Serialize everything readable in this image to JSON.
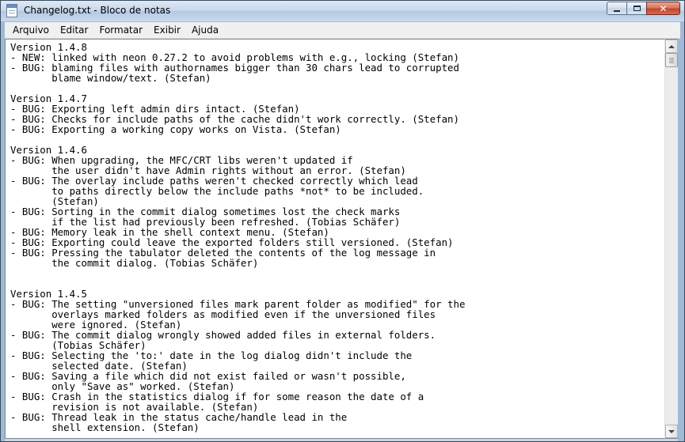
{
  "window": {
    "title": "Changelog.txt - Bloco de notas",
    "caption_buttons": {
      "minimize": "minimize",
      "maximize": "maximize",
      "close": "close"
    }
  },
  "menubar": {
    "items": [
      {
        "label": "Arquivo"
      },
      {
        "label": "Editar"
      },
      {
        "label": "Formatar"
      },
      {
        "label": "Exibir"
      },
      {
        "label": "Ajuda"
      }
    ]
  },
  "editor": {
    "lines": [
      "Version 1.4.8",
      "- NEW: linked with neon 0.27.2 to avoid problems with e.g., locking (Stefan)",
      "- BUG: blaming files with authornames bigger than 30 chars lead to corrupted",
      "       blame window/text. (Stefan)",
      "",
      "Version 1.4.7",
      "- BUG: Exporting left admin dirs intact. (Stefan)",
      "- BUG: Checks for include paths of the cache didn't work correctly. (Stefan)",
      "- BUG: Exporting a working copy works on Vista. (Stefan)",
      "",
      "Version 1.4.6",
      "- BUG: When upgrading, the MFC/CRT libs weren't updated if",
      "       the user didn't have Admin rights without an error. (Stefan)",
      "- BUG: The overlay include paths weren't checked correctly which lead",
      "       to paths directly below the include paths *not* to be included.",
      "       (Stefan)",
      "- BUG: Sorting in the commit dialog sometimes lost the check marks",
      "       if the list had previously been refreshed. (Tobias Schäfer)",
      "- BUG: Memory leak in the shell context menu. (Stefan)",
      "- BUG: Exporting could leave the exported folders still versioned. (Stefan)",
      "- BUG: Pressing the tabulator deleted the contents of the log message in",
      "       the commit dialog. (Tobias Schäfer)",
      "",
      "",
      "Version 1.4.5",
      "- BUG: The setting \"unversioned files mark parent folder as modified\" for the",
      "       overlays marked folders as modified even if the unversioned files",
      "       were ignored. (Stefan)",
      "- BUG: The commit dialog wrongly showed added files in external folders.",
      "       (Tobias Schäfer)",
      "- BUG: Selecting the 'to:' date in the log dialog didn't include the",
      "       selected date. (Stefan)",
      "- BUG: Saving a file which did not exist failed or wasn't possible,",
      "       only \"Save as\" worked. (Stefan)",
      "- BUG: Crash in the statistics dialog if for some reason the date of a",
      "       revision is not available. (Stefan)",
      "- BUG: Thread leak in the status cache/handle lead in the",
      "       shell extension. (Stefan)"
    ]
  },
  "scrollbar": {
    "up_icon": "scroll-up-arrow",
    "down_icon": "scroll-down-arrow",
    "position": 0.0
  }
}
